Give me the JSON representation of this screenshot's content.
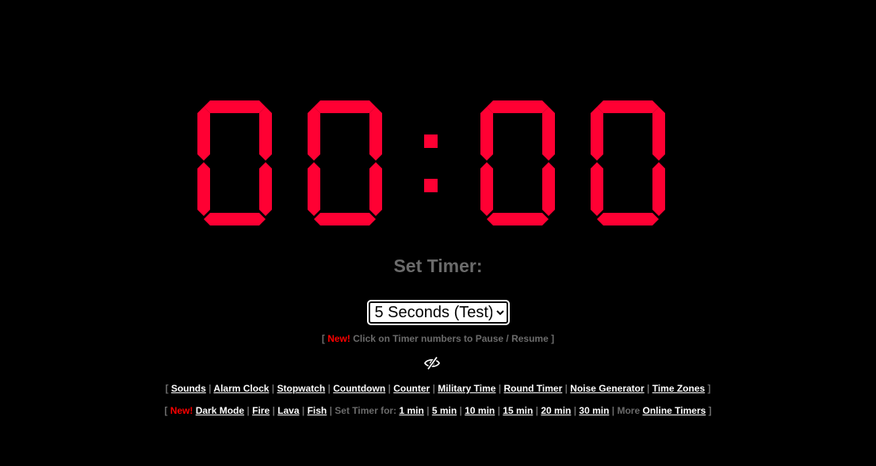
{
  "timer": {
    "display": "00:00",
    "digits": [
      "0",
      "0",
      "0",
      "0"
    ],
    "color": "#ff0033"
  },
  "set_timer": {
    "title": "Set Timer:",
    "selected": "5 Seconds (Test)"
  },
  "hint": {
    "new_label": "New!",
    "text": "Click on Timer numbers to Pause / Resume",
    "open": "[",
    "close": "]"
  },
  "eye_icon": "eye-slash-icon",
  "nav_row1": {
    "open": "[",
    "close": "]",
    "links": [
      "Sounds",
      "Alarm Clock",
      "Stopwatch",
      "Countdown",
      "Counter",
      "Military Time",
      "Round Timer",
      "Noise Generator",
      "Time Zones"
    ]
  },
  "nav_row2": {
    "open": "[",
    "close": "]",
    "new_label": "New!",
    "links": [
      "Dark Mode",
      "Fire",
      "Lava",
      "Fish"
    ],
    "set_timer_label": "Set Timer for:",
    "timer_links": [
      "1 min",
      "5 min",
      "10 min",
      "15 min",
      "20 min",
      "30 min"
    ],
    "more_label": "More",
    "more_link": "Online Timers"
  }
}
